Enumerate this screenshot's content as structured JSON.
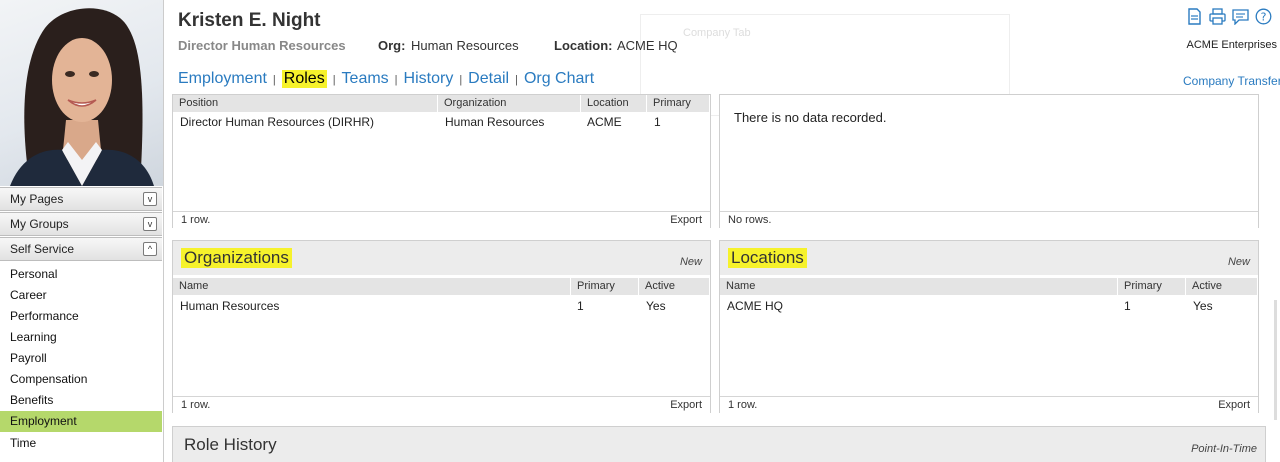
{
  "employee": {
    "name": "Kristen E. Night",
    "title": "Director Human Resources",
    "org_label": "Org:",
    "org_value": "Human Resources",
    "location_label": "Location:",
    "location_value": "ACME HQ",
    "company": "ACME Enterprises"
  },
  "ghost_text": "Company Tab",
  "tabs": [
    {
      "label": "Employment"
    },
    {
      "label": "Roles",
      "highlighted": true
    },
    {
      "label": "Teams"
    },
    {
      "label": "History"
    },
    {
      "label": "Detail"
    },
    {
      "label": "Org Chart"
    }
  ],
  "tab_separator": "|",
  "company_transfer": "Company Transfer",
  "header_icons": [
    "document-icon",
    "print-icon",
    "comment-icon",
    "help-icon"
  ],
  "sidebar": {
    "groups": [
      {
        "label": "My Pages",
        "toggle": "v"
      },
      {
        "label": "My Groups",
        "toggle": "v"
      },
      {
        "label": "Self Service",
        "toggle": "^"
      }
    ],
    "items": [
      {
        "label": "Personal"
      },
      {
        "label": "Career"
      },
      {
        "label": "Performance"
      },
      {
        "label": "Learning"
      },
      {
        "label": "Payroll"
      },
      {
        "label": "Compensation"
      },
      {
        "label": "Benefits"
      },
      {
        "label": "Employment",
        "active": true
      },
      {
        "label": "Time"
      }
    ]
  },
  "positions_panel": {
    "columns": [
      "Position",
      "Organization",
      "Location",
      "Primary"
    ],
    "rows": [
      {
        "position": "Director Human Resources (DIRHR)",
        "organization": "Human Resources",
        "location": "ACME",
        "primary": "1"
      }
    ],
    "footer_count": "1 row.",
    "export": "Export"
  },
  "right_top_panel": {
    "empty_text": "There is no data recorded.",
    "footer_count": "No rows."
  },
  "organizations_panel": {
    "title": "Organizations",
    "new_label": "New",
    "columns": [
      "Name",
      "Primary",
      "Active"
    ],
    "rows": [
      {
        "name": "Human Resources",
        "primary": "1",
        "active": "Yes"
      }
    ],
    "footer_count": "1 row.",
    "export": "Export"
  },
  "locations_panel": {
    "title": "Locations",
    "new_label": "New",
    "columns": [
      "Name",
      "Primary",
      "Active"
    ],
    "rows": [
      {
        "name": "ACME HQ",
        "primary": "1",
        "active": "Yes"
      }
    ],
    "footer_count": "1 row.",
    "export": "Export"
  },
  "role_history_panel": {
    "title": "Role History",
    "action_label": "Point-In-Time"
  },
  "colors": {
    "accent_link": "#2a7bc0",
    "highlight": "#f6f22b",
    "active_nav": "#b5d86b"
  }
}
